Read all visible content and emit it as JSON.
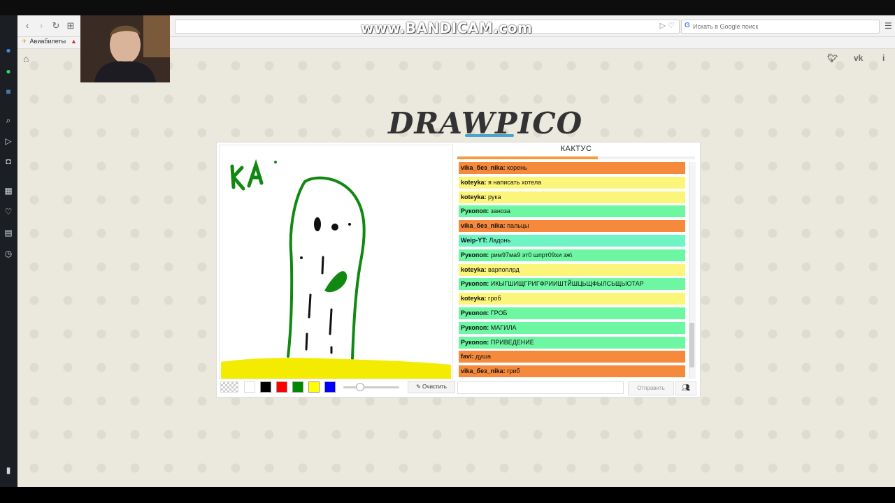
{
  "browser": {
    "nav": {
      "back": "‹",
      "forward": "›",
      "reload": "↻",
      "grid": "⊞"
    },
    "search_placeholder": "Искать в Google поиск",
    "bookmarks": [
      {
        "label": "Авиабилеты"
      }
    ]
  },
  "overlay": {
    "watermark": "www.BANDICAM.com"
  },
  "page": {
    "logo": "DRAWPICO",
    "icons": {
      "home": "home-icon",
      "twitter": "twitter-icon",
      "vk": "vk-icon",
      "info": "info-icon"
    }
  },
  "game": {
    "word": "КАКТУС",
    "timer_fraction": 0.59,
    "canvas_text": "KA",
    "palette": [
      "#000000",
      "#ff0000",
      "#008800",
      "#ffff00",
      "#0000ff"
    ],
    "brush_size_fraction": 0.28,
    "clear_label": "Очистить",
    "send_label": "Отправить",
    "messages": [
      {
        "user": "vika_без_nika",
        "text": "корень",
        "color": "#f58a3c"
      },
      {
        "user": "koteyka",
        "text": "я написать хотела",
        "color": "#fbf57a"
      },
      {
        "user": "koteyka",
        "text": "рука",
        "color": "#fbf57a"
      },
      {
        "user": "Рукопоп",
        "text": "заноза",
        "color": "#6ef7a3"
      },
      {
        "user": "vika_без_nika",
        "text": "пальцы",
        "color": "#f58a3c"
      },
      {
        "user": "Weip-YT",
        "text": "Ладонь",
        "color": "#6ef5c3"
      },
      {
        "user": "Рукопоп",
        "text": "рим97ма9 эт0 шпрт09хи зж\\",
        "color": "#6ef7a3"
      },
      {
        "user": "koteyka",
        "text": "варпоплрд",
        "color": "#fbf57a"
      },
      {
        "user": "Рукопоп",
        "text": "ИКЫГШИЩГРИГФРИИШТЙШЦЬЩФЫЛСЬЩЫОТАР",
        "color": "#6ef7a3"
      },
      {
        "user": "koteyka",
        "text": "гроб",
        "color": "#fbf57a"
      },
      {
        "user": "Рукопоп",
        "text": "ГРОБ",
        "color": "#6ef7a3"
      },
      {
        "user": "Рукопоп",
        "text": "МАГИЛА",
        "color": "#6ef7a3"
      },
      {
        "user": "Рукопоп",
        "text": "ПРИВЕДЕНИЕ",
        "color": "#6ef7a3"
      },
      {
        "user": "favi",
        "text": "душа",
        "color": "#f58a3c"
      },
      {
        "user": "vika_без_nika",
        "text": "гриб",
        "color": "#f58a3c"
      }
    ]
  }
}
